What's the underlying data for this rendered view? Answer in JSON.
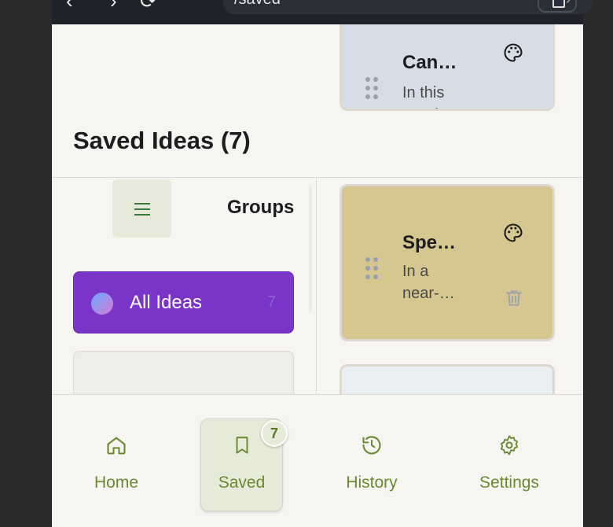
{
  "browser": {
    "url": "/saved"
  },
  "page": {
    "title": "Saved Ideas (7)"
  },
  "sidebar": {
    "groups_label": "Groups",
    "all_ideas": {
      "label": "All Ideas",
      "count": "7"
    }
  },
  "cards": [
    {
      "title": "Can…",
      "snippet": "In this psych…",
      "color": "#d7dde6"
    },
    {
      "title": "Spe…",
      "snippet": "In a near-…",
      "color": "#d5c78f"
    }
  ],
  "bottom_nav": [
    {
      "label": "Home",
      "icon": "home-icon"
    },
    {
      "label": "Saved",
      "icon": "bookmark-icon",
      "badge": "7"
    },
    {
      "label": "History",
      "icon": "history-icon"
    },
    {
      "label": "Settings",
      "icon": "gear-icon"
    }
  ],
  "colors": {
    "accent": "#7a35c8",
    "nav_green": "#6a8a30",
    "menu_green": "#3d7a3f"
  }
}
